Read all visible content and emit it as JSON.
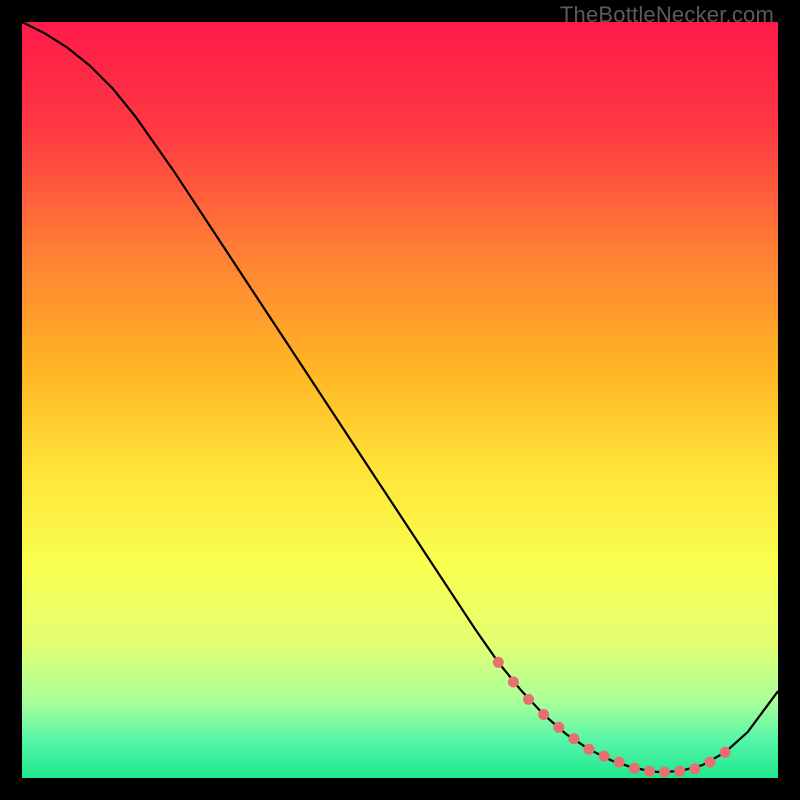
{
  "watermark": "TheBottleNecker.com",
  "chart_data": {
    "type": "line",
    "title": "",
    "xlabel": "",
    "ylabel": "",
    "xlim": [
      0,
      100
    ],
    "ylim": [
      0,
      100
    ],
    "grid": false,
    "background_gradient": {
      "stops": [
        {
          "pos": 0.0,
          "color": "#ff1a4a"
        },
        {
          "pos": 0.15,
          "color": "#ff3b42"
        },
        {
          "pos": 0.3,
          "color": "#ff7e35"
        },
        {
          "pos": 0.45,
          "color": "#ffb224"
        },
        {
          "pos": 0.6,
          "color": "#ffe63a"
        },
        {
          "pos": 0.72,
          "color": "#f8ff50"
        },
        {
          "pos": 0.82,
          "color": "#e4ff72"
        },
        {
          "pos": 0.9,
          "color": "#a7ff9a"
        },
        {
          "pos": 0.95,
          "color": "#56f5a8"
        },
        {
          "pos": 1.0,
          "color": "#1ee890"
        }
      ]
    },
    "series": [
      {
        "name": "curve",
        "stroke": "#000000",
        "x": [
          0,
          3,
          6,
          9,
          12,
          15,
          20,
          25,
          30,
          35,
          40,
          45,
          50,
          55,
          60,
          63,
          66,
          69,
          72,
          75,
          78,
          81,
          84,
          87,
          90,
          93,
          96,
          100
        ],
        "y": [
          100,
          98.5,
          96.6,
          94.2,
          91.2,
          87.5,
          80.4,
          72.8,
          65.2,
          57.6,
          50.0,
          42.4,
          34.8,
          27.2,
          19.6,
          15.3,
          11.6,
          8.4,
          5.8,
          3.8,
          2.3,
          1.3,
          0.8,
          0.9,
          1.7,
          3.4,
          6.1,
          11.5
        ]
      }
    ],
    "markers": {
      "name": "highlight-dots",
      "color": "#e6706f",
      "x": [
        63,
        65,
        67,
        69,
        71,
        73,
        75,
        77,
        79,
        81,
        83,
        85,
        87,
        89,
        91,
        93
      ],
      "y": [
        15.3,
        12.7,
        10.4,
        8.4,
        6.7,
        5.2,
        3.8,
        2.9,
        2.1,
        1.3,
        0.9,
        0.8,
        0.9,
        1.2,
        2.1,
        3.4
      ]
    }
  }
}
